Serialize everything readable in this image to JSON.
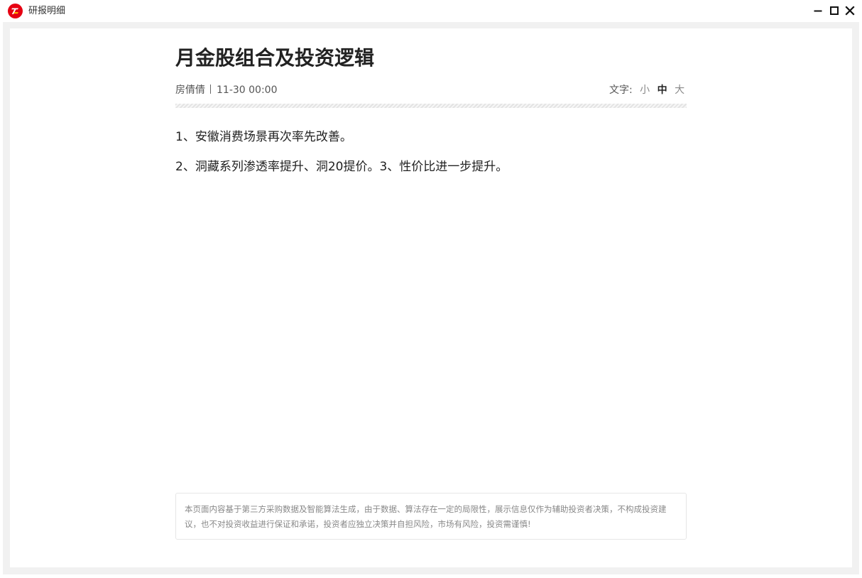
{
  "window": {
    "title": "研报明细",
    "controls": {
      "minimize": "minimize",
      "maximize": "maximize",
      "close": "close"
    },
    "logo_color": "#e60012"
  },
  "article": {
    "title": "月金股组合及投资逻辑",
    "author": "房倩倩",
    "time": "11-30 00:00",
    "paragraphs": [
      "1、安徽消费场景再次率先改善。",
      "2、洞藏系列渗透率提升、洞20提价。3、性价比进一步提升。"
    ]
  },
  "font_switch": {
    "label": "文字:",
    "options": [
      "小",
      "中",
      "大"
    ],
    "selected": "中"
  },
  "disclaimer": {
    "text": "本页面内容基于第三方采购数据及智能算法生成，由于数据、算法存在一定的局限性，展示信息仅作为辅助投资者决策，不构成投资建议，也不对投资收益进行保证和承诺，投资者应独立决策并自担风险，市场有风险，投资需谨慎!"
  }
}
